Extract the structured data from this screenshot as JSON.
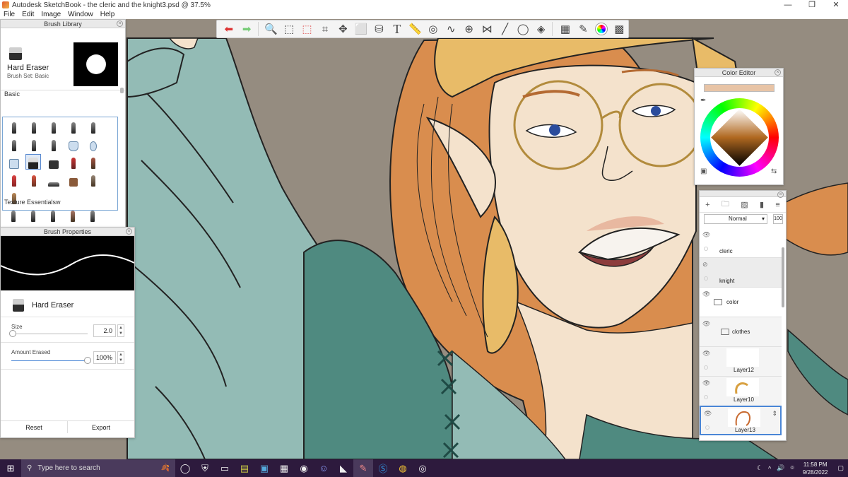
{
  "window": {
    "title": "Autodesk SketchBook - the cleric and the knight3.psd @ 37.5%",
    "controls": [
      "—",
      "❐",
      "✕"
    ]
  },
  "menu": [
    "File",
    "Edit",
    "Image",
    "Window",
    "Help"
  ],
  "toolbar": {
    "tools": [
      {
        "icon": "undo-icon",
        "glyph": "⬅"
      },
      {
        "icon": "redo-icon",
        "glyph": "➡"
      },
      {
        "icon": "zoom-icon",
        "glyph": "🔍"
      },
      {
        "icon": "select-icon",
        "glyph": "⬚"
      },
      {
        "icon": "lasso-select-icon",
        "glyph": "⬚"
      },
      {
        "icon": "crop-icon",
        "glyph": "⌗"
      },
      {
        "icon": "move-icon",
        "glyph": "✥"
      },
      {
        "icon": "transform-icon",
        "glyph": "⬜"
      },
      {
        "icon": "fill-icon",
        "glyph": "⛁"
      },
      {
        "icon": "text-icon",
        "glyph": "T"
      },
      {
        "icon": "ruler-icon",
        "glyph": "📏"
      },
      {
        "icon": "ellipse-guide-icon",
        "glyph": "◎"
      },
      {
        "icon": "french-curve-icon",
        "glyph": "∿"
      },
      {
        "icon": "perspective-icon",
        "glyph": "⊕"
      },
      {
        "icon": "symmetry-icon",
        "glyph": "⋈"
      },
      {
        "icon": "stroke-line-icon",
        "glyph": "╱"
      },
      {
        "icon": "stroke-ellipse-icon",
        "glyph": "◯"
      },
      {
        "icon": "shape-icon",
        "glyph": "◈"
      },
      {
        "icon": "layers-toggle-icon",
        "glyph": "▦"
      },
      {
        "icon": "brush-library-icon",
        "glyph": "✎"
      },
      {
        "icon": "color-wheel-icon",
        "glyph": "◐"
      },
      {
        "icon": "copic-palette-icon",
        "glyph": "▩"
      }
    ]
  },
  "brush_library": {
    "title": "Brush Library",
    "current_brush": "Hard Eraser",
    "brush_set": "Brush Set: Basic",
    "section_basic": "Basic",
    "section_texture": "Texture Essentialsw"
  },
  "brush_properties": {
    "title": "Brush Properties",
    "brush_name": "Hard Eraser",
    "size_label": "Size",
    "size_value": "2.0",
    "amount_label": "Amount Erased",
    "amount_value": "100%",
    "amount_level": 1.0,
    "size_level": 0.02,
    "reset_label": "Reset",
    "export_label": "Export"
  },
  "color_editor": {
    "title": "Color Editor",
    "current_color": "#e8c4a6"
  },
  "layers": {
    "blend_mode": "Normal",
    "opacity": "100",
    "items": [
      {
        "name": "cleric",
        "type": "layer",
        "visible": true
      },
      {
        "name": "knight",
        "type": "layer",
        "visible": false
      },
      {
        "name": "color",
        "type": "folder",
        "visible": true
      },
      {
        "name": "clothes",
        "type": "folder",
        "visible": true
      },
      {
        "name": "Layer12",
        "type": "layer",
        "visible": true
      },
      {
        "name": "Layer10",
        "type": "layer",
        "visible": true
      },
      {
        "name": "Layer13",
        "type": "layer",
        "visible": true,
        "selected": true
      }
    ]
  },
  "taskbar": {
    "search_placeholder": "Type here to search",
    "time": "11:58 PM",
    "date": "9/28/2022"
  },
  "colors": {
    "canvas_background": "#958c80",
    "skin": "#f4e2cc",
    "hair": "#d98d4e",
    "cloth_light": "#93bbb5",
    "cloth_dark": "#4f8a80",
    "hair_band": "#e8bb68",
    "accent": "#4a86d6"
  }
}
